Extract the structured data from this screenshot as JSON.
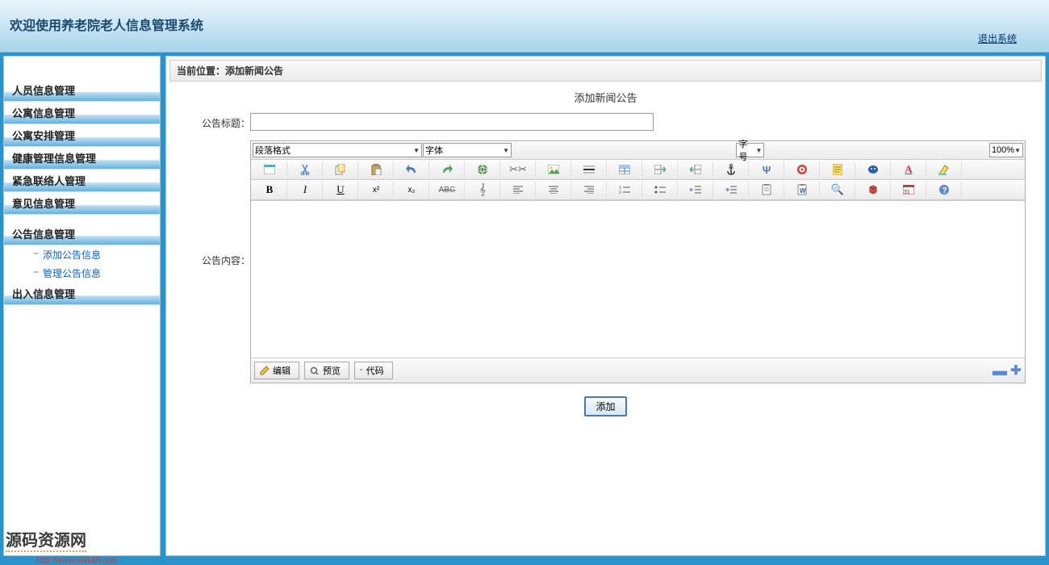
{
  "header": {
    "title": "欢迎使用养老院老人信息管理系统",
    "logout": "退出系统"
  },
  "sidebar": {
    "items": [
      "人员信息管理",
      "公寓信息管理",
      "公寓安排管理",
      "健康管理信息管理",
      "紧急联络人管理",
      "意见信息管理",
      "公告信息管理",
      "出入信息管理"
    ],
    "subs": [
      "添加公告信息",
      "管理公告信息"
    ]
  },
  "watermark": {
    "text": "源码资源网",
    "url": "http://www.net168.com"
  },
  "breadcrumb": "当前位置：添加新闻公告",
  "form": {
    "caption": "添加新闻公告",
    "title_label": "公告标题：",
    "content_label": "公告内容：",
    "submit": "添加"
  },
  "editor": {
    "para": "段落格式",
    "font": "字体",
    "size": "字号",
    "zoom": "100%",
    "modes": {
      "edit": "编辑",
      "preview": "预览",
      "code": "代码"
    }
  }
}
